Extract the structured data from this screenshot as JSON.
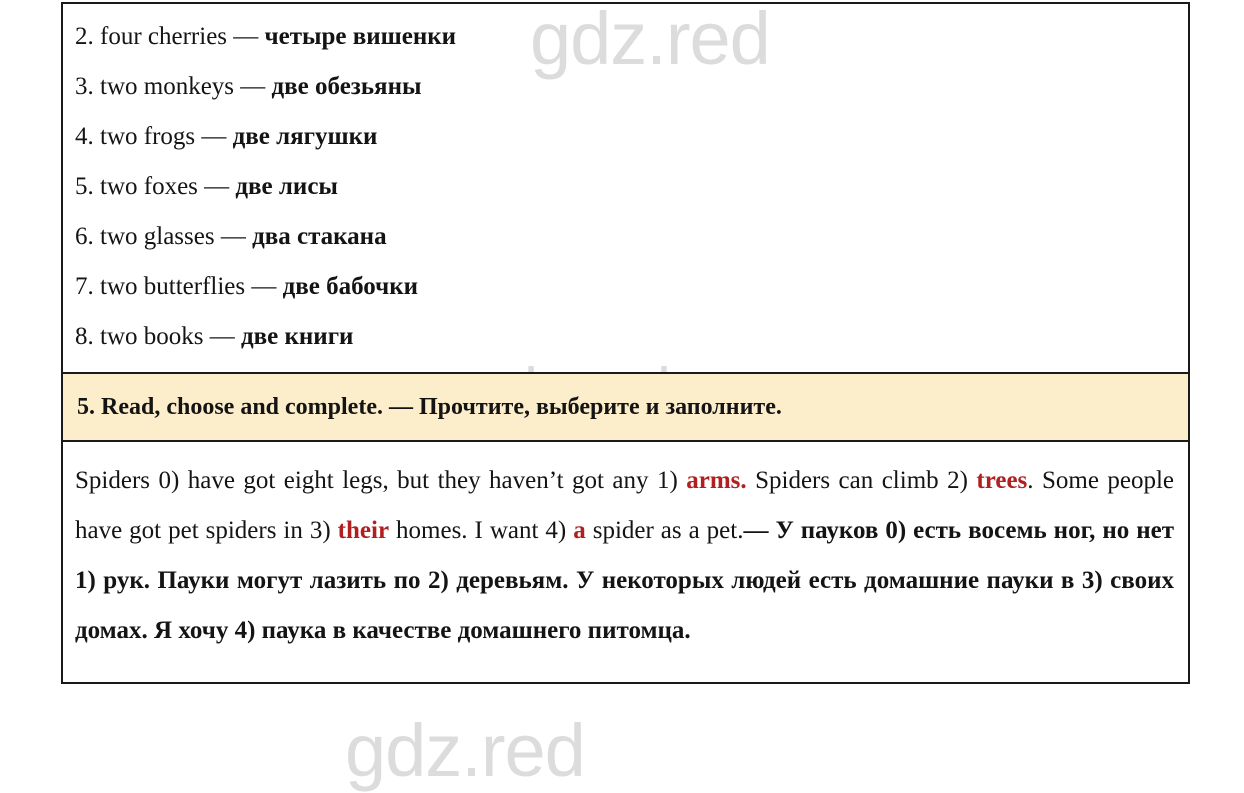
{
  "watermark": {
    "text": "gdz.red",
    "color": "#dcdcdc",
    "occurrences": 3
  },
  "colors": {
    "task_band_background": "#fdeecb",
    "border": "#1a1a1a",
    "answer_highlight": "#b02020",
    "text": "#141414"
  },
  "exercise_list": {
    "items": [
      {
        "number": "2.",
        "english": "four cherries",
        "dash": "—",
        "russian": "четыре вишенки"
      },
      {
        "number": "3.",
        "english": "two monkeys",
        "dash": "—",
        "russian": "две обезьяны"
      },
      {
        "number": "4.",
        "english": "two frogs",
        "dash": "—",
        "russian": "две лягушки"
      },
      {
        "number": "5.",
        "english": "two foxes",
        "dash": "—",
        "russian": "две лисы"
      },
      {
        "number": "6.",
        "english": "two glasses",
        "dash": "—",
        "russian": "два стакана"
      },
      {
        "number": "7.",
        "english": "two butterflies",
        "dash": "—",
        "russian": "две бабочки"
      },
      {
        "number": "8.",
        "english": "two books",
        "dash": "—",
        "russian": "две книги"
      }
    ]
  },
  "task_header": {
    "number": "5.",
    "english": "Read, choose and complete.",
    "dash": "—",
    "russian": "Прочтите, выберите и заполните."
  },
  "answer": {
    "english": {
      "seg1": "Spiders 0) have got eight legs, but they haven’t got any 1)",
      "blank1": "arms.",
      "seg2": "Spiders can climb 2)",
      "blank2": "trees",
      "seg3": ". Some people have got pet spiders in 3)",
      "blank3": "their",
      "seg4": "homes. I want 4)",
      "blank4": "a",
      "seg5": "spider as a pet."
    },
    "russian": {
      "dash": "—",
      "text": "У пауков 0) есть восемь ног, но нет 1) рук. Пауки могут лазить по 2) деревьям. У некоторых людей есть домашние пауки в 3) своих домах. Я хочу 4) паука в качестве домашнего питомца."
    }
  }
}
